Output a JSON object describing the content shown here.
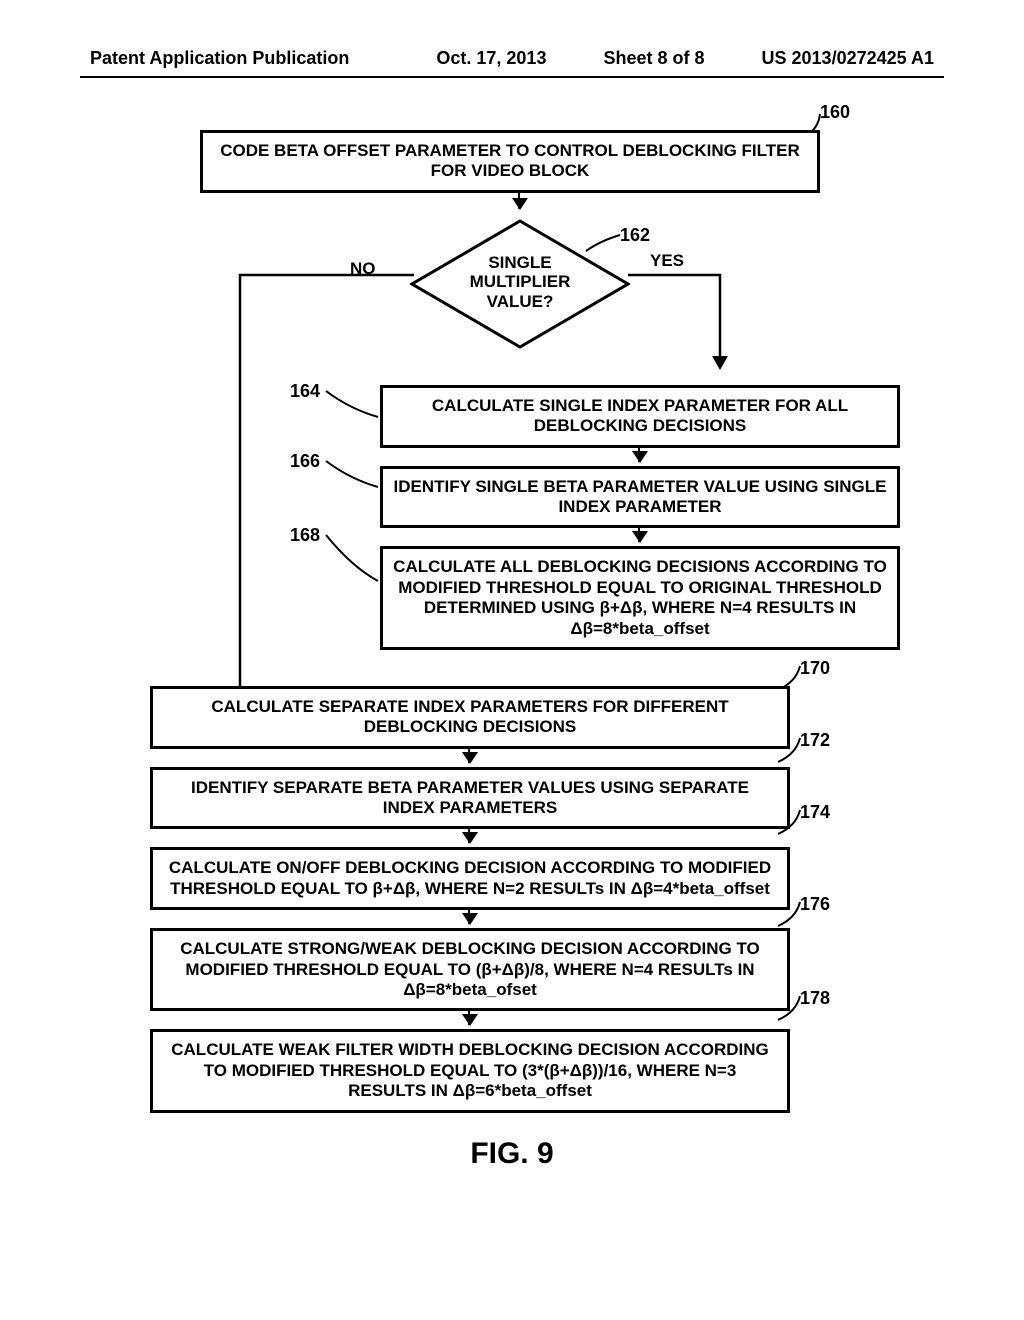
{
  "header": {
    "left": "Patent Application Publication",
    "mid1": "Oct. 17, 2013",
    "mid2": "Sheet 8 of 8",
    "right": "US 2013/0272425 A1"
  },
  "refs": {
    "r160": "160",
    "r162": "162",
    "r164": "164",
    "r166": "166",
    "r168": "168",
    "r170": "170",
    "r172": "172",
    "r174": "174",
    "r176": "176",
    "r178": "178"
  },
  "decision": {
    "no": "NO",
    "yes": "YES",
    "line1": "SINGLE",
    "line2": "MULTIPLIER",
    "line3": "VALUE?"
  },
  "boxes": {
    "top": "CODE BETA OFFSET PARAMETER TO CONTROL DEBLOCKING FILTER FOR VIDEO BLOCK",
    "y1": "CALCULATE SINGLE INDEX PARAMETER FOR ALL DEBLOCKING DECISIONS",
    "y2": "IDENTIFY SINGLE BETA PARAMETER VALUE USING SINGLE INDEX PARAMETER",
    "y3": "CALCULATE ALL DEBLOCKING DECISIONS ACCORDING TO MODIFIED THRESHOLD EQUAL TO ORIGINAL THRESHOLD DETERMINED USING β+Δβ, WHERE N=4 RESULTS IN Δβ=8*beta_offset",
    "n1": "CALCULATE SEPARATE INDEX PARAMETERS FOR DIFFERENT DEBLOCKING DECISIONS",
    "n2": "IDENTIFY SEPARATE BETA PARAMETER VALUES USING SEPARATE INDEX PARAMETERS",
    "n3": "CALCULATE ON/OFF DEBLOCKING DECISION ACCORDING TO MODIFIED THRESHOLD EQUAL TO β+Δβ, WHERE N=2 RESULTs IN Δβ=4*beta_offset",
    "n4": "CALCULATE STRONG/WEAK DEBLOCKING DECISION ACCORDING TO MODIFIED THRESHOLD EQUAL TO (β+Δβ)/8, WHERE N=4 RESULTs IN Δβ=8*beta_ofset",
    "n5": "CALCULATE WEAK FILTER WIDTH DEBLOCKING DECISION ACCORDING TO MODIFIED THRESHOLD EQUAL TO (3*(β+Δβ))/16, WHERE N=3 RESULTS IN Δβ=6*beta_offset"
  },
  "caption": "FIG. 9"
}
